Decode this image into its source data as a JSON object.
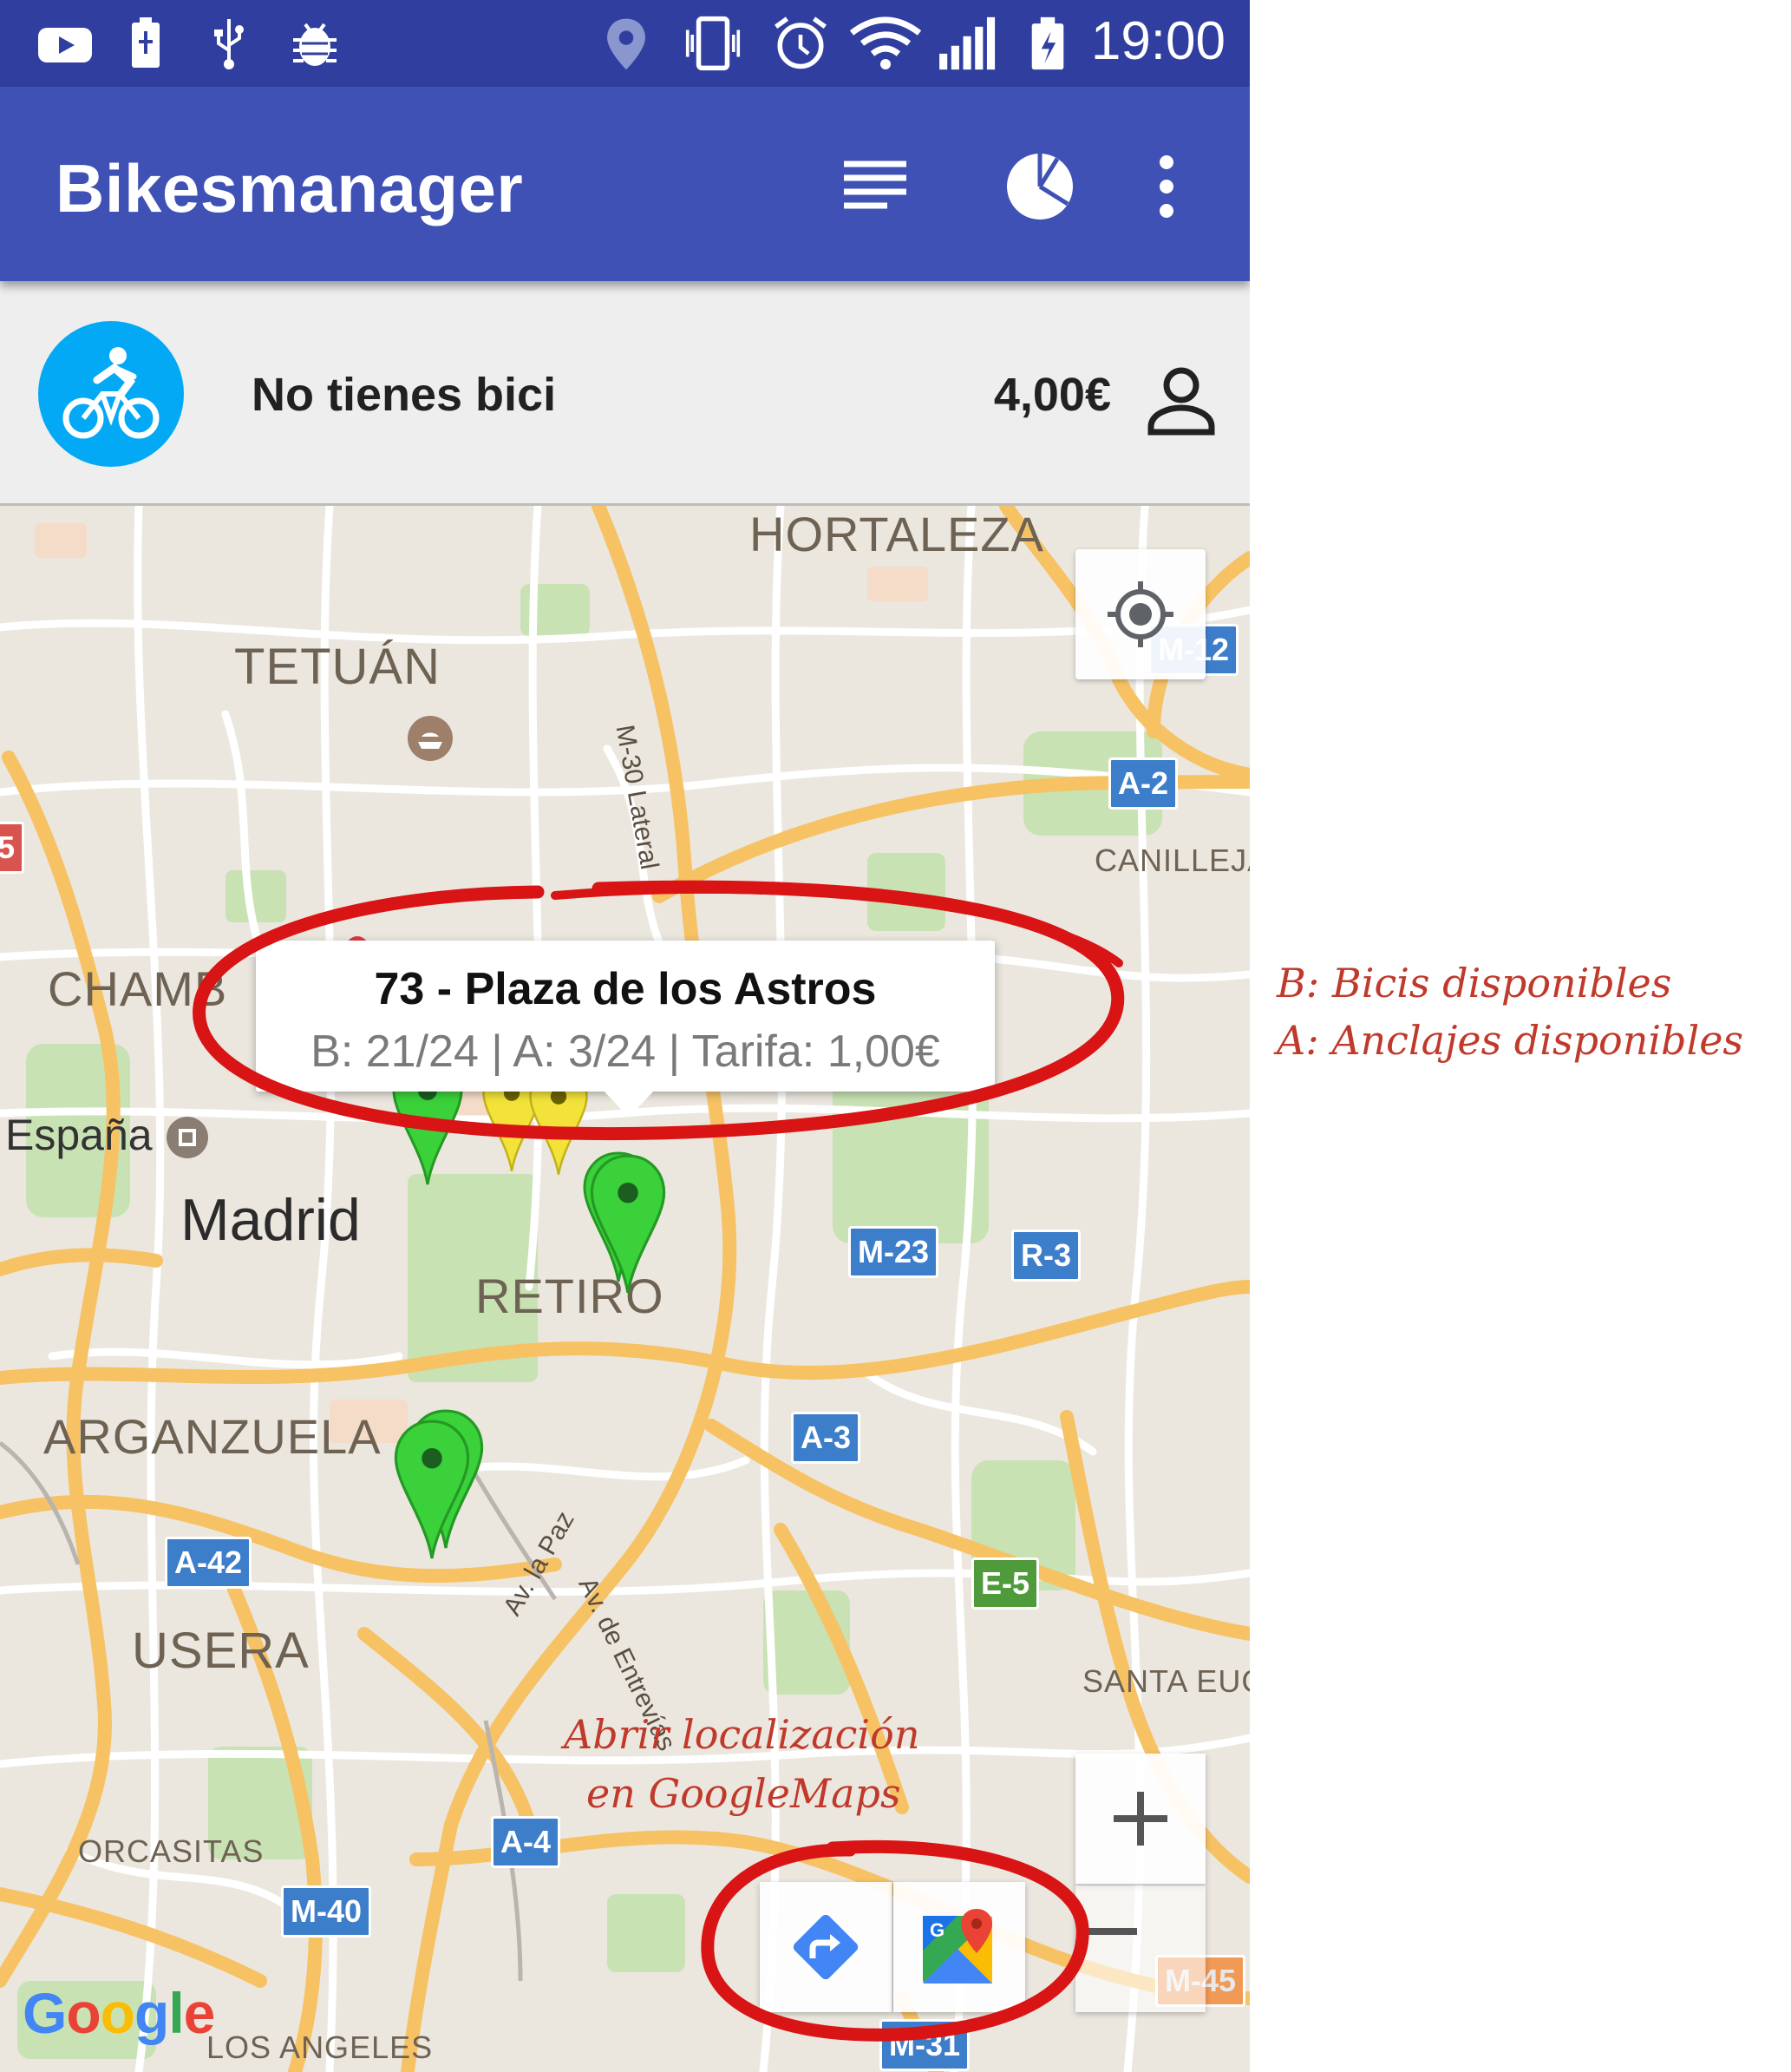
{
  "status_bar": {
    "time": "19:00",
    "icons": [
      "youtube-icon",
      "battery-saver-icon",
      "usb-icon",
      "android-debug-icon",
      "location-icon",
      "vibrate-icon",
      "alarm-icon",
      "wifi-icon",
      "signal-icon",
      "battery-charging-icon"
    ]
  },
  "app_bar": {
    "title": "Bikesmanager",
    "actions": [
      "list-icon",
      "pie-chart-icon",
      "overflow-menu-icon"
    ]
  },
  "user": {
    "status": "No tienes bici",
    "balance": "4,00€"
  },
  "info_window": {
    "title": "73 - Plaza de los Astros",
    "detail": "B: 21/24 | A: 3/24 | Tarifa: 1,00€"
  },
  "map": {
    "labels": {
      "hortaleza": "HORTALEZA",
      "tetuan": "TETUÁN",
      "chamberi": "CHAMB",
      "espana": "España",
      "madrid": "Madrid",
      "retiro": "RETIRO",
      "arganzuela": "ARGANZUELA",
      "usera": "USERA",
      "orcasitas": "ORCASITAS",
      "los_angeles": "LOS ANGELES",
      "canillejas": "CANILLEJA",
      "santa_eugenia": "SANTA EUGI",
      "m30_lateral": "M-30 Lateral",
      "av_la_paz": "Av. la Paz",
      "av_entrevias": "Av. de Entrevías"
    },
    "shields": {
      "m12": "M-12",
      "a2": "A-2",
      "m23": "M-23",
      "r3": "R-3",
      "a3": "A-3",
      "e5": "E-5",
      "a42": "A-42",
      "a4": "A-4",
      "m40": "M-40",
      "m31": "M-31",
      "m45": "M-45",
      "edge": "5"
    },
    "google_logo": "Google",
    "colors": {
      "station_available": "#3ad13a",
      "station_low": "#f2e23a",
      "appbar": "#3f51b5",
      "statusbar": "#303f9f",
      "accent_blue": "#03a9f4",
      "annotation": "#c0392b"
    }
  },
  "annotations": {
    "legend_b": "B: Bicis disponibles",
    "legend_a": "A: Anclajes disponibles",
    "open_maps_line1": "Abrir localización",
    "open_maps_line2": "en GoogleMaps"
  }
}
